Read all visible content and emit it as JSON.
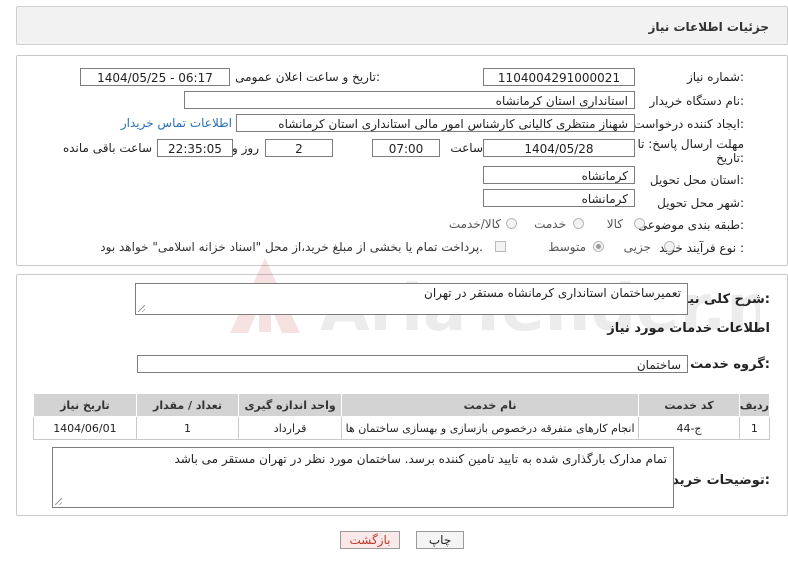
{
  "header": {
    "title": "جزئیات اطلاعات نیاز"
  },
  "fields": {
    "need_number_label": "شماره نیاز:",
    "need_number": "1104004291000021",
    "announce_label": "تاریخ و ساعت اعلان عمومی:",
    "announce_value": "1404/05/25 - 06:17",
    "buyer_org_label": "نام دستگاه خریدار:",
    "buyer_org": "استانداری استان کرمانشاه",
    "creator_label": "ایجاد کننده درخواست:",
    "creator": "شهناز منتظری کالیانی کارشناس امور مالی استانداری استان کرمانشاه",
    "contact_link": "اطلاعات تماس خریدار",
    "deadline_label_1": "مهلت ارسال پاسخ: تا",
    "deadline_label_2": "تاریخ:",
    "deadline_date": "1404/05/28",
    "time_label": "ساعت",
    "deadline_time": "07:00",
    "days_value": "2",
    "days_label": "روز و",
    "remaining_time": "22:35:05",
    "remaining_label": "ساعت باقی مانده",
    "province_label": "استان محل تحویل:",
    "province": "کرمانشاه",
    "city_label": "شهر محل تحویل:",
    "city": "کرمانشاه",
    "category_label": "طبقه بندی موضوعی:",
    "category_options": [
      "کالا",
      "خدمت",
      "کالا/خدمت"
    ],
    "process_label": "نوع فرآیند خرید :",
    "process_options": [
      "جزیی",
      "متوسط"
    ],
    "payment_note": "پرداخت تمام یا بخشی از مبلغ خرید،از محل \"اسناد خزانه اسلامی\" خواهد بود."
  },
  "summary": {
    "label": "شرح کلی نیاز:",
    "text": "تعمیرساختمان استانداری کرمانشاه مستقر در تهران"
  },
  "services": {
    "section_title": "اطلاعات خدمات مورد نیاز",
    "group_label": "گروه خدمت:",
    "group_value": "ساختمان",
    "columns": [
      "ردیف",
      "کد خدمت",
      "نام خدمت",
      "واحد اندازه گیری",
      "تعداد / مقدار",
      "تاریخ نیاز"
    ],
    "rows": [
      [
        "1",
        "ج-44",
        "انجام کارهای متفرقه درخصوص بازسازی و بهسازی ساختمان ها",
        "قرارداد",
        "1",
        "1404/06/01"
      ]
    ]
  },
  "buyer_notes": {
    "label": "توضیحات خریدار:",
    "text": "تمام مدارک بارگذاری شده به تایید تامین کننده برسد. ساختمان مورد نظر در تهران مستقر می باشد"
  },
  "buttons": {
    "print": "چاپ",
    "back": "بازگشت"
  },
  "watermark": {
    "text": "AriaTender.net"
  },
  "colors": {
    "link": "#2a6fb8",
    "back_button_text": "#c0392b",
    "header_bg": "#f2f2f2",
    "table_header_bg": "#d3d3d3"
  }
}
